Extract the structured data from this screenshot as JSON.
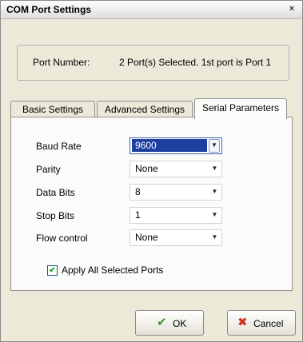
{
  "window": {
    "title": "COM Port Settings",
    "close_icon": "×"
  },
  "port": {
    "label": "Port Number:",
    "value": "2 Port(s) Selected. 1st port is Port 1"
  },
  "tabs": [
    {
      "label": "Basic Settings",
      "active": false
    },
    {
      "label": "Advanced Settings",
      "active": false
    },
    {
      "label": "Serial Parameters",
      "active": true
    }
  ],
  "fields": [
    {
      "label": "Baud Rate",
      "value": "9600",
      "focused": true
    },
    {
      "label": "Parity",
      "value": "None",
      "focused": false
    },
    {
      "label": "Data Bits",
      "value": "8",
      "focused": false
    },
    {
      "label": "Stop Bits",
      "value": "1",
      "focused": false
    },
    {
      "label": "Flow control",
      "value": "None",
      "focused": false
    }
  ],
  "apply_all": {
    "label": "Apply All Selected Ports",
    "checked": true
  },
  "buttons": {
    "ok": {
      "label": "OK",
      "icon": "checkmark-icon",
      "color": "#3a9a2a"
    },
    "cancel": {
      "label": "Cancel",
      "icon": "x-icon",
      "color": "#d03020"
    }
  }
}
